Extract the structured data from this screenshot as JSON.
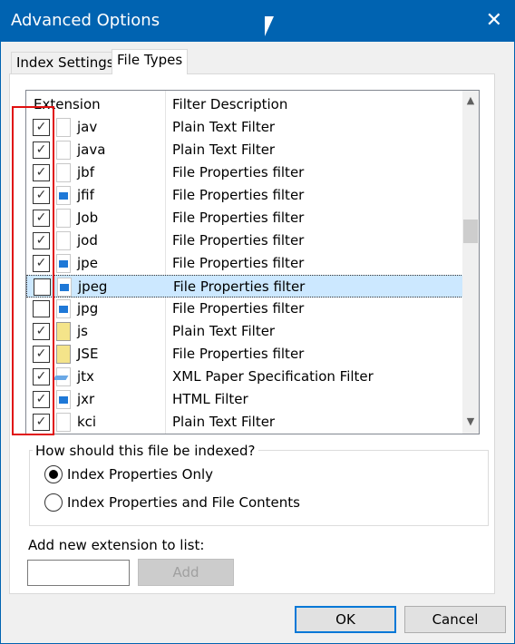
{
  "window": {
    "title": "Advanced Options"
  },
  "tabs": [
    {
      "label": "Index Settings",
      "active": false
    },
    {
      "label": "File Types",
      "active": true
    }
  ],
  "list": {
    "headers": {
      "extension": "Extension",
      "description": "Filter Description"
    },
    "rows": [
      {
        "ext": "jav",
        "desc": "Plain Text Filter",
        "checked": true,
        "icon": "blank"
      },
      {
        "ext": "java",
        "desc": "Plain Text Filter",
        "checked": true,
        "icon": "blank"
      },
      {
        "ext": "jbf",
        "desc": "File Properties filter",
        "checked": true,
        "icon": "blank"
      },
      {
        "ext": "jfif",
        "desc": "File Properties filter",
        "checked": true,
        "icon": "img"
      },
      {
        "ext": "Job",
        "desc": "File Properties filter",
        "checked": true,
        "icon": "blank"
      },
      {
        "ext": "jod",
        "desc": "File Properties filter",
        "checked": true,
        "icon": "blank"
      },
      {
        "ext": "jpe",
        "desc": "File Properties filter",
        "checked": true,
        "icon": "img"
      },
      {
        "ext": "jpeg",
        "desc": "File Properties filter",
        "checked": false,
        "icon": "img",
        "selected": true
      },
      {
        "ext": "jpg",
        "desc": "File Properties filter",
        "checked": false,
        "icon": "img"
      },
      {
        "ext": "js",
        "desc": "Plain Text Filter",
        "checked": true,
        "icon": "script"
      },
      {
        "ext": "JSE",
        "desc": "File Properties filter",
        "checked": true,
        "icon": "script"
      },
      {
        "ext": "jtx",
        "desc": "XML Paper Specification Filter",
        "checked": true,
        "icon": "xps"
      },
      {
        "ext": "jxr",
        "desc": "HTML Filter",
        "checked": true,
        "icon": "img"
      },
      {
        "ext": "kci",
        "desc": "Plain Text Filter",
        "checked": true,
        "icon": "blank"
      }
    ]
  },
  "index_group": {
    "label": "How should this file be indexed?",
    "options": [
      {
        "label": "Index Properties Only",
        "selected": true
      },
      {
        "label": "Index Properties and File Contents",
        "selected": false
      }
    ]
  },
  "add": {
    "label": "Add new extension to list:",
    "value": "",
    "button": "Add"
  },
  "buttons": {
    "ok": "OK",
    "cancel": "Cancel"
  },
  "colors": {
    "titlebar": "#0063b1",
    "highlight": "#e01010",
    "selection": "#cce8ff"
  }
}
